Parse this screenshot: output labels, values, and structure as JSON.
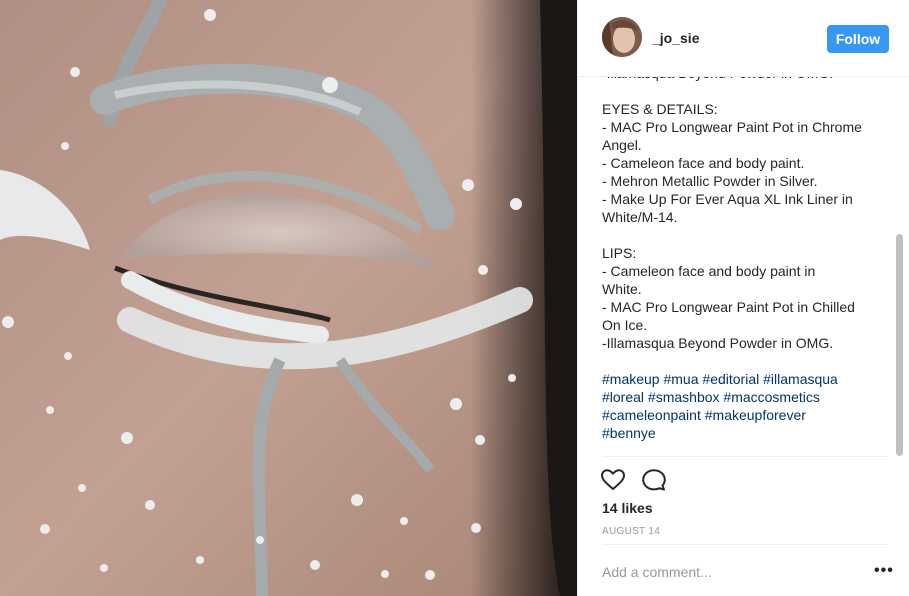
{
  "post": {
    "username": "_jo_sie",
    "follow_label": "Follow",
    "caption": [
      "-Illamasqua Beyond Powder in OMG.",
      "",
      "EYES & DETAILS:",
      "- MAC Pro Longwear Paint Pot in Chrome",
      "Angel.",
      "- Cameleon face and body paint.",
      "- Mehron Metallic Powder in Silver.",
      "- Make Up For Ever Aqua XL Ink Liner in",
      "White/M-14.",
      "",
      "LIPS:",
      "- Cameleon face and body paint in",
      "White.",
      "- MAC Pro Longwear Paint Pot in Chilled",
      "On Ice.",
      "-Illamasqua Beyond Powder in OMG.",
      ""
    ],
    "hashtag_lines": [
      [
        "#makeup",
        "#mua",
        "#editorial",
        "#illamasqua"
      ],
      [
        "#loreal",
        "#smashbox",
        "#maccosmetics"
      ],
      [
        "#cameleonpaint",
        "#makeupforever"
      ],
      [
        "#bennye"
      ]
    ],
    "likes": "14 likes",
    "date": "AUGUST 14",
    "add_comment_placeholder": "Add a comment...",
    "more_label": "•••"
  },
  "icons": {
    "like": "heart-icon",
    "comment": "comment-icon"
  },
  "colors": {
    "follow_button": "#3897f0",
    "hashtag": "#003569",
    "muted_text": "#999999"
  }
}
